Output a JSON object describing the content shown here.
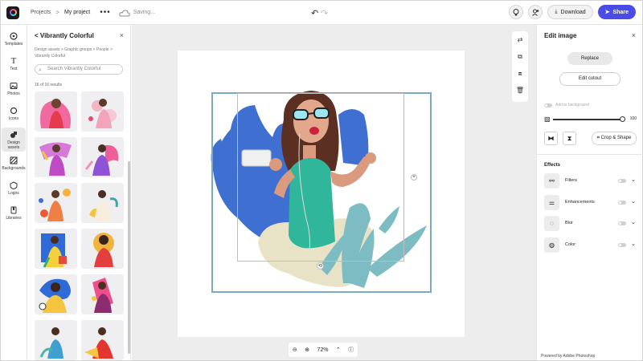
{
  "topbar": {
    "breadcrumb_root": "Projects",
    "breadcrumb_sep": ">",
    "project_name": "My project",
    "more": "•••",
    "status": "Saving...",
    "download_label": "Download",
    "share_label": "Share"
  },
  "rail": {
    "items": [
      {
        "label": "Templates",
        "icon": "templates-icon"
      },
      {
        "label": "Text",
        "icon": "text-icon"
      },
      {
        "label": "Photos",
        "icon": "photos-icon"
      },
      {
        "label": "Icons",
        "icon": "icons-icon"
      },
      {
        "label": "Design assets",
        "icon": "design-assets-icon"
      },
      {
        "label": "Backgrounds",
        "icon": "backgrounds-icon"
      },
      {
        "label": "Logos",
        "icon": "logos-icon"
      },
      {
        "label": "Libraries",
        "icon": "libraries-icon"
      }
    ]
  },
  "assets_panel": {
    "title": "< Vibrantly Colorful",
    "close": "×",
    "breadcrumb": "Design assets  >  Graphic groups  >  People  >  Vibrantly Colorful",
    "search_placeholder": "Search Vibrantly Colorful",
    "results": "16 of 16 results"
  },
  "canvas": {
    "zoom_level": "72%"
  },
  "edit_panel": {
    "title": "Edit image",
    "close": "×",
    "replace_label": "Replace",
    "edit_cutout_label": "Edit cutout",
    "add_to_background_label": "Add to background",
    "opacity_value": "100",
    "crop_shape_label": "Crop & Shape",
    "effects_heading": "Effects",
    "effects": [
      {
        "label": "Filters",
        "icon": "filters-icon"
      },
      {
        "label": "Enhancements",
        "icon": "enhancements-icon"
      },
      {
        "label": "Blur",
        "icon": "blur-icon"
      },
      {
        "label": "Color",
        "icon": "color-icon"
      }
    ],
    "powered_by": "Powered by Adobe Photoshop"
  },
  "colors": {
    "accent": "#4b4be6",
    "blob_blue": "#3f6fd1",
    "leaf_teal": "#7cbcc2",
    "blob_beige": "#e8e2c6",
    "frame_border": "#79a9c4"
  }
}
